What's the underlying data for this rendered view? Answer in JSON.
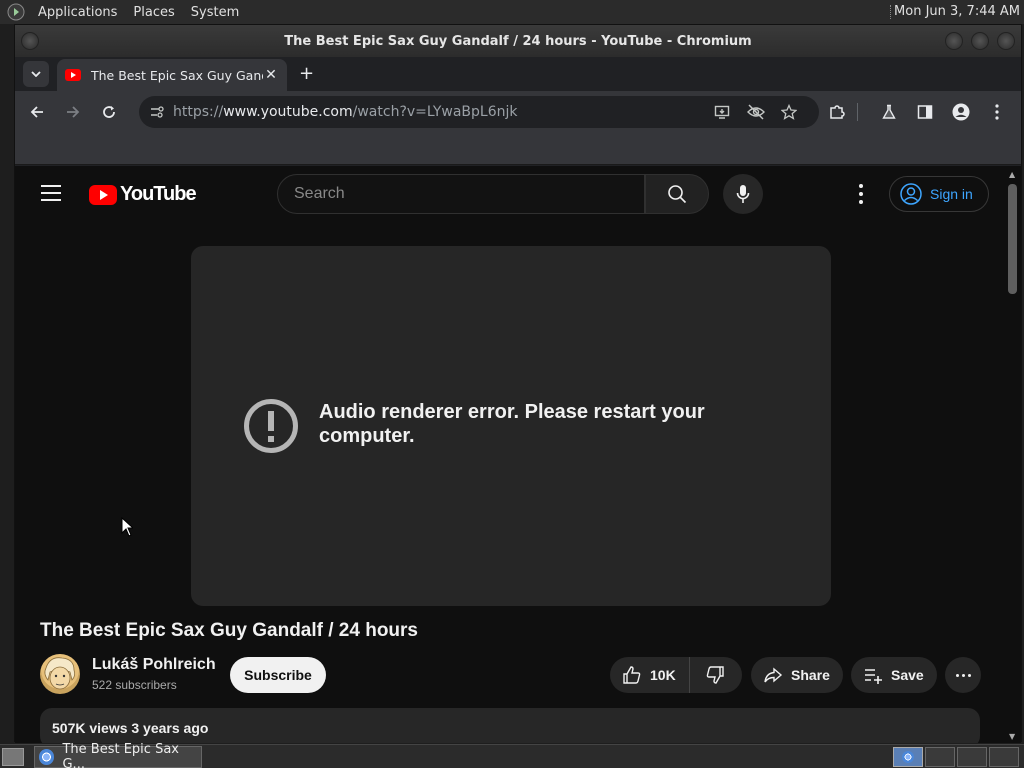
{
  "panel": {
    "menus": [
      "Applications",
      "Places",
      "System"
    ],
    "clock": "Mon Jun  3,  7:44 AM"
  },
  "window": {
    "title": "The Best Epic Sax Guy Gandalf / 24 hours - YouTube - Chromium"
  },
  "tabs": [
    {
      "title": "The Best Epic Sax Guy Gandalf / 24 hours - YouTube",
      "close": "✕"
    }
  ],
  "toolbar": {
    "url_scheme": "https://",
    "url_host": "www.youtube.com",
    "url_path": "/watch?v=LYwaBpL6njk",
    "new_tab": "+"
  },
  "youtube": {
    "logo_text": "YouTube",
    "search_placeholder": "Search",
    "sign_in": "Sign in",
    "error_message": "Audio renderer error. Please restart your computer.",
    "video_title": "The Best Epic Sax Guy Gandalf / 24 hours",
    "channel_name": "Lukáš Pohlreich",
    "subscribers": "522 subscribers",
    "subscribe": "Subscribe",
    "likes": "10K",
    "share": "Share",
    "save": "Save",
    "views_line": "507K views  3 years ago"
  },
  "taskbar": {
    "task_label": "The Best Epic Sax G..."
  },
  "colors": {
    "youtube_red": "#ff0000",
    "link_blue": "#3ea6ff",
    "page_bg": "#0f0f0f"
  }
}
